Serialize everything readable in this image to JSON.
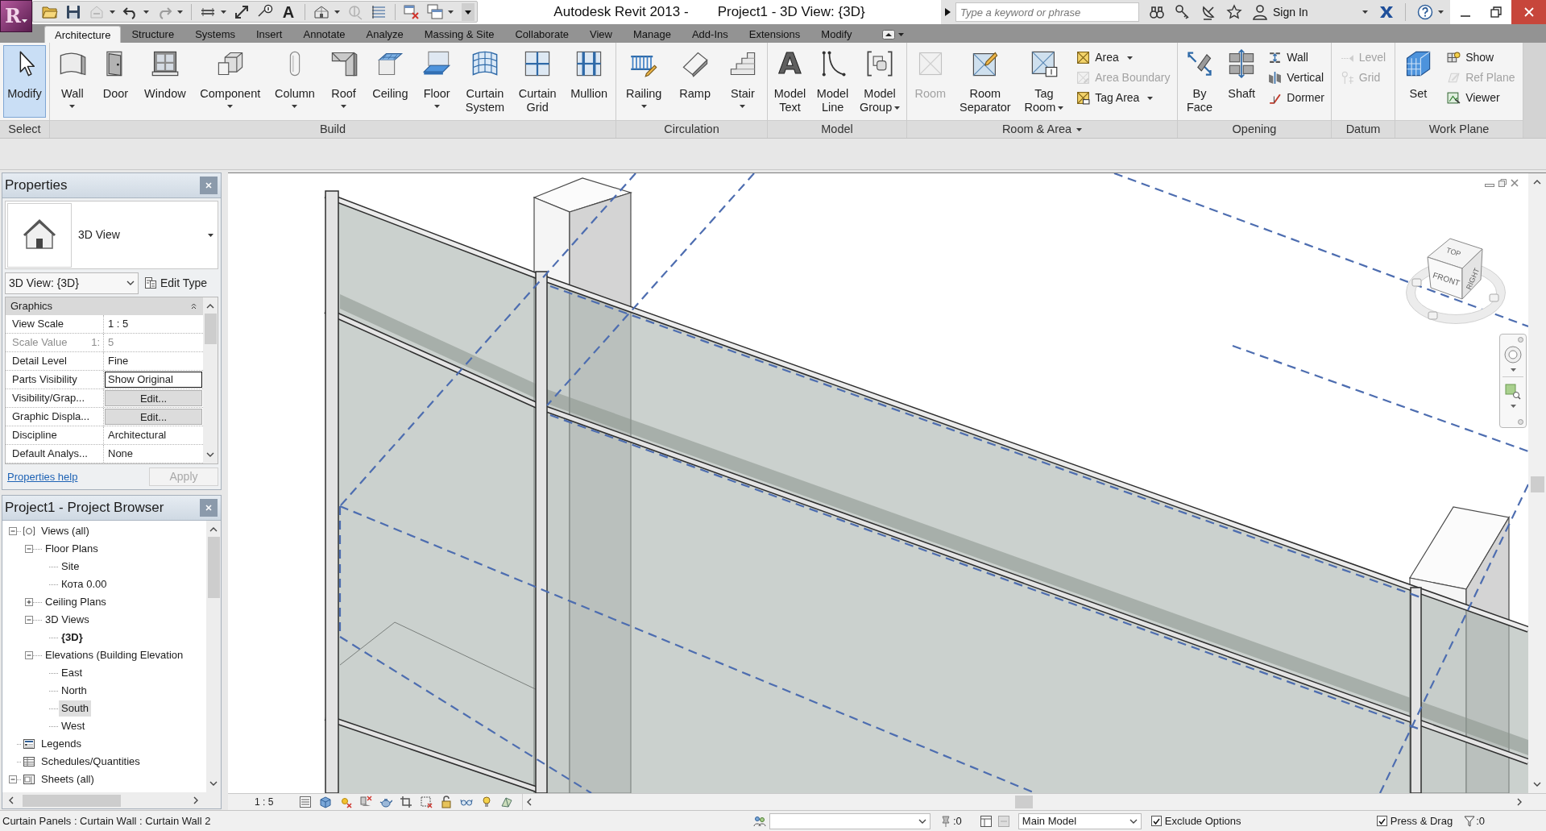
{
  "app_menu": {
    "logo_letter": "R"
  },
  "quick_access": [
    {
      "dropdown": false,
      "disabled": false
    },
    {
      "dropdown": false,
      "disabled": false
    },
    {
      "dropdown": true,
      "disabled": true
    },
    {
      "dropdown": true,
      "disabled": false
    },
    {
      "dropdown": true,
      "disabled": true
    },
    {
      "dropdown": true,
      "disabled": false
    },
    {
      "dropdown": false,
      "disabled": false
    },
    {
      "dropdown": false,
      "disabled": false
    },
    {
      "glyph": "A",
      "dropdown": false,
      "disabled": false
    },
    {
      "dropdown": true,
      "disabled": false
    },
    {
      "dropdown": false,
      "disabled": true
    },
    {
      "dropdown": false,
      "disabled": false
    },
    {
      "dropdown": false,
      "disabled": false
    },
    {
      "dropdown": true,
      "disabled": false
    }
  ],
  "title_bar": {
    "app_title": "Autodesk Revit 2013 -",
    "document_title": "Project1 - 3D View: {3D}",
    "search": {
      "placeholder": "Type a keyword or phrase"
    },
    "sign_in": "Sign In"
  },
  "ribbon_tabs": [
    {
      "label": "Architecture",
      "selected": true
    },
    {
      "label": "Structure",
      "selected": false
    },
    {
      "label": "Systems",
      "selected": false
    },
    {
      "label": "Insert",
      "selected": false
    },
    {
      "label": "Annotate",
      "selected": false
    },
    {
      "label": "Analyze",
      "selected": false
    },
    {
      "label": "Massing & Site",
      "selected": false
    },
    {
      "label": "Collaborate",
      "selected": false
    },
    {
      "label": "View",
      "selected": false
    },
    {
      "label": "Manage",
      "selected": false
    },
    {
      "label": "Add-Ins",
      "selected": false
    },
    {
      "label": "Extensions",
      "selected": false
    },
    {
      "label": "Modify",
      "selected": false
    }
  ],
  "ribbon_panels": [
    {
      "label": "Select",
      "dropdown": false,
      "tools": [
        {
          "kind": "large",
          "label": "Modify",
          "selected": true,
          "disabled": false,
          "dropdown": false
        }
      ]
    },
    {
      "label": "Build",
      "dropdown": false,
      "tools": [
        {
          "kind": "large",
          "label": "Wall",
          "selected": false,
          "disabled": false,
          "dropdown": true
        },
        {
          "kind": "large",
          "label": "Door",
          "selected": false,
          "disabled": false,
          "dropdown": false
        },
        {
          "kind": "large",
          "label": "Window",
          "selected": false,
          "disabled": false,
          "dropdown": false
        },
        {
          "kind": "large",
          "label": "Component",
          "selected": false,
          "disabled": false,
          "dropdown": true
        },
        {
          "kind": "large",
          "label": "Column",
          "selected": false,
          "disabled": false,
          "dropdown": true
        },
        {
          "kind": "large",
          "label": "Roof",
          "selected": false,
          "disabled": false,
          "dropdown": true
        },
        {
          "kind": "large",
          "label": "Ceiling",
          "selected": false,
          "disabled": false,
          "dropdown": false
        },
        {
          "kind": "large",
          "label": "Floor",
          "selected": false,
          "disabled": false,
          "dropdown": true
        },
        {
          "kind": "large",
          "label": "Curtain\nSystem",
          "selected": false,
          "disabled": false,
          "dropdown": false
        },
        {
          "kind": "large",
          "label": "Curtain\nGrid",
          "selected": false,
          "disabled": false,
          "dropdown": false
        },
        {
          "kind": "large",
          "label": "Mullion",
          "selected": false,
          "disabled": false,
          "dropdown": false
        }
      ]
    },
    {
      "label": "Circulation",
      "dropdown": false,
      "tools": [
        {
          "kind": "large",
          "label": "Railing",
          "selected": false,
          "disabled": false,
          "dropdown": true
        },
        {
          "kind": "large",
          "label": "Ramp",
          "selected": false,
          "disabled": false,
          "dropdown": false
        },
        {
          "kind": "large",
          "label": "Stair",
          "selected": false,
          "disabled": false,
          "dropdown": true
        }
      ]
    },
    {
      "label": "Model",
      "dropdown": false,
      "tools": [
        {
          "kind": "large",
          "label": "Model\nText",
          "glyph": "A",
          "selected": false,
          "disabled": false,
          "dropdown": false
        },
        {
          "kind": "large",
          "label": "Model\nLine",
          "selected": false,
          "disabled": false,
          "dropdown": false
        },
        {
          "kind": "large",
          "label": "Model\nGroup",
          "selected": false,
          "disabled": false,
          "dropdown": true
        }
      ]
    },
    {
      "label": "Room & Area",
      "dropdown": true,
      "tools": [
        {
          "kind": "large",
          "label": "Room",
          "selected": false,
          "disabled": true,
          "dropdown": false
        },
        {
          "kind": "large",
          "label": "Room\nSeparator",
          "selected": false,
          "disabled": false,
          "dropdown": false
        },
        {
          "kind": "large",
          "label": "Tag\nRoom",
          "selected": false,
          "disabled": false,
          "dropdown": true
        },
        {
          "kind": "small",
          "label": "Area",
          "selected": false,
          "disabled": false,
          "dropdown": true
        },
        {
          "kind": "small",
          "label": "Area Boundary",
          "selected": false,
          "disabled": true,
          "dropdown": false
        },
        {
          "kind": "small",
          "label": "Tag Area",
          "selected": false,
          "disabled": false,
          "dropdown": true
        }
      ]
    },
    {
      "label": "Opening",
      "dropdown": false,
      "tools": [
        {
          "kind": "large",
          "label": "By\nFace",
          "selected": false,
          "disabled": false,
          "dropdown": false
        },
        {
          "kind": "large",
          "label": "Shaft",
          "selected": false,
          "disabled": false,
          "dropdown": false
        },
        {
          "kind": "small",
          "label": "Wall",
          "selected": false,
          "disabled": false,
          "dropdown": false
        },
        {
          "kind": "small",
          "label": "Vertical",
          "selected": false,
          "disabled": false,
          "dropdown": false
        },
        {
          "kind": "small",
          "label": "Dormer",
          "selected": false,
          "disabled": false,
          "dropdown": false
        }
      ]
    },
    {
      "label": "Datum",
      "dropdown": false,
      "tools": [
        {
          "kind": "small",
          "label": "Level",
          "selected": false,
          "disabled": true,
          "dropdown": false
        },
        {
          "kind": "small",
          "label": "Grid",
          "selected": false,
          "disabled": true,
          "dropdown": false
        }
      ]
    },
    {
      "label": "Work Plane",
      "dropdown": false,
      "tools": [
        {
          "kind": "large",
          "label": "Set",
          "selected": false,
          "disabled": false,
          "dropdown": false
        },
        {
          "kind": "small",
          "label": "Show",
          "selected": false,
          "disabled": false,
          "dropdown": false
        },
        {
          "kind": "small",
          "label": "Ref Plane",
          "selected": false,
          "disabled": true,
          "dropdown": false
        },
        {
          "kind": "small",
          "label": "Viewer",
          "selected": false,
          "disabled": false,
          "dropdown": false
        }
      ]
    }
  ],
  "properties": {
    "title": "Properties",
    "type_selector": "3D View",
    "instance": "3D View: {3D}",
    "edit_type": "Edit Type",
    "group": {
      "label": "Graphics",
      "expanded": true
    },
    "rows": [
      {
        "name": "View Scale",
        "value": "1 : 5",
        "kind": "text",
        "disabled": false,
        "focused": false
      },
      {
        "name": "Scale Value",
        "name_suffix": "1:",
        "value": "5",
        "kind": "text",
        "disabled": true,
        "focused": false
      },
      {
        "name": "Detail Level",
        "value": "Fine",
        "kind": "text",
        "disabled": false,
        "focused": false
      },
      {
        "name": "Parts Visibility",
        "value": "Show Original",
        "kind": "text",
        "disabled": false,
        "focused": true
      },
      {
        "name": "Visibility/Grap...",
        "value": "Edit...",
        "kind": "button",
        "disabled": false,
        "focused": false
      },
      {
        "name": "Graphic Displa...",
        "value": "Edit...",
        "kind": "button",
        "disabled": false,
        "focused": false
      },
      {
        "name": "Discipline",
        "value": "Architectural",
        "kind": "text",
        "disabled": false,
        "focused": false
      },
      {
        "name": "Default Analys...",
        "value": "None",
        "kind": "text",
        "disabled": false,
        "focused": false
      }
    ],
    "help_link": "Properties help",
    "apply": {
      "label": "Apply",
      "disabled": true
    }
  },
  "project_browser": {
    "title": "Project1 - Project Browser",
    "tree": [
      {
        "label": "Views (all)",
        "kind": "views",
        "expanded": true,
        "selected": false,
        "current": false,
        "children": [
          {
            "label": "Floor Plans",
            "expanded": true,
            "selected": false,
            "current": false,
            "children": [
              {
                "label": "Site",
                "selected": false,
                "current": false
              },
              {
                "label": "Кота 0.00",
                "selected": false,
                "current": false
              }
            ]
          },
          {
            "label": "Ceiling Plans",
            "expanded": false,
            "selected": false,
            "current": false
          },
          {
            "label": "3D Views",
            "expanded": true,
            "selected": false,
            "current": false,
            "children": [
              {
                "label": "{3D}",
                "selected": false,
                "current": true
              }
            ]
          },
          {
            "label": "Elevations (Building Elevation",
            "expanded": true,
            "selected": false,
            "current": false,
            "children": [
              {
                "label": "East",
                "selected": false,
                "current": false
              },
              {
                "label": "North",
                "selected": false,
                "current": false
              },
              {
                "label": "South",
                "selected": true,
                "current": false
              },
              {
                "label": "West",
                "selected": false,
                "current": false
              }
            ]
          }
        ]
      },
      {
        "label": "Legends",
        "kind": "legends",
        "selected": false,
        "current": false
      },
      {
        "label": "Schedules/Quantities",
        "kind": "schedules",
        "selected": false,
        "current": false
      },
      {
        "label": "Sheets (all)",
        "kind": "sheets",
        "expanded": true,
        "selected": false,
        "current": false
      }
    ]
  },
  "view": {
    "scale": "1 : 5",
    "view_cube": {
      "faces": [
        "TOP",
        "FRONT",
        "RIGHT"
      ]
    }
  },
  "status_bar": {
    "message": "Curtain Panels : Curtain Wall : Curtain Wall 2",
    "counter": ":0",
    "design_option": "Main Model",
    "exclude_options": {
      "label": "Exclude Options",
      "checked": true
    },
    "press_drag": {
      "label": "Press & Drag",
      "checked": true
    },
    "filter_count": ":0"
  }
}
